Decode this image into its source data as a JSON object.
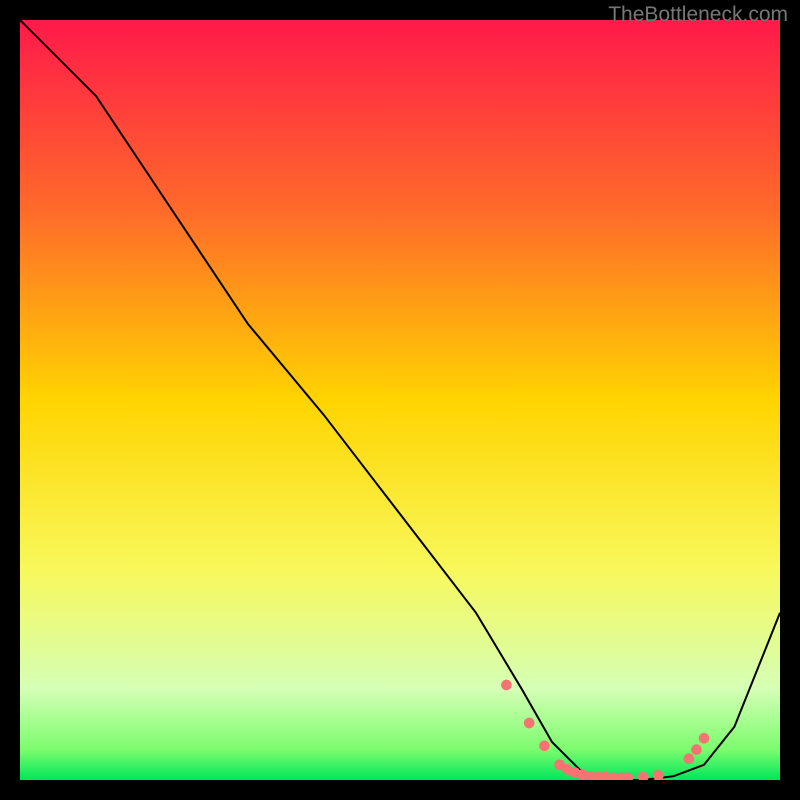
{
  "watermark": "TheBottleneck.com",
  "chart_data": {
    "type": "line",
    "title": "",
    "xlabel": "",
    "ylabel": "",
    "xlim": [
      0,
      100
    ],
    "ylim": [
      0,
      100
    ],
    "gradient_stops": [
      {
        "offset": 0,
        "color": "#ff1a4a"
      },
      {
        "offset": 25,
        "color": "#ff6a2a"
      },
      {
        "offset": 50,
        "color": "#ffd400"
      },
      {
        "offset": 72,
        "color": "#f8f85a"
      },
      {
        "offset": 88,
        "color": "#d5ffb5"
      },
      {
        "offset": 96,
        "color": "#7CFC6E"
      },
      {
        "offset": 100,
        "color": "#00e65a"
      }
    ],
    "series": [
      {
        "name": "curve",
        "color": "#000000",
        "x": [
          0,
          10,
          20,
          30,
          40,
          50,
          60,
          66,
          70,
          74,
          78,
          82,
          86,
          90,
          94,
          100
        ],
        "y": [
          100,
          90,
          75,
          60,
          48,
          35,
          22,
          12,
          5,
          1,
          0,
          0,
          0.5,
          2,
          7,
          22
        ]
      }
    ],
    "markers": {
      "name": "bottom-points",
      "color": "#f47373",
      "radius": 5,
      "x": [
        64,
        67,
        69,
        71,
        72,
        73,
        74,
        75,
        76,
        77,
        78,
        79,
        80,
        82,
        84,
        88,
        89,
        90
      ],
      "y": [
        12.5,
        7.5,
        4.5,
        2,
        1.4,
        1,
        0.7,
        0.5,
        0.4,
        0.4,
        0.3,
        0.3,
        0.3,
        0.4,
        0.6,
        2.8,
        4,
        5.5
      ]
    }
  }
}
